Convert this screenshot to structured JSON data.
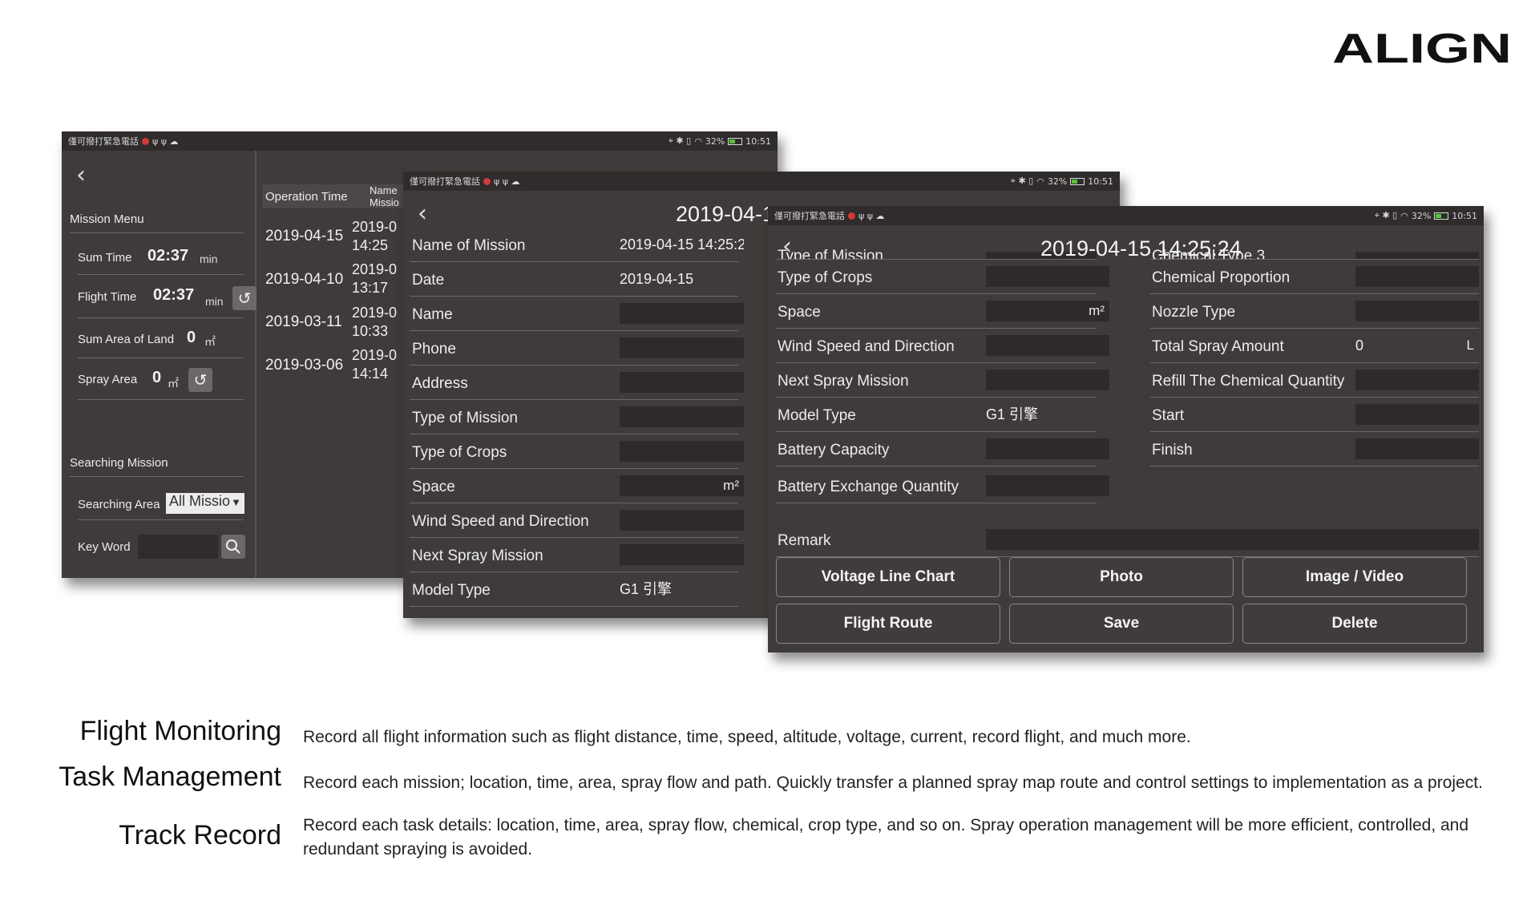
{
  "brand": {
    "logo_text": "ALIGN"
  },
  "status_bar": {
    "left_text": "僅可撥打緊急電話",
    "battery": "32%",
    "time": "10:51"
  },
  "screen1": {
    "mission_menu": "Mission Menu",
    "sum_time_label": "Sum Time",
    "sum_time_value": "02:37",
    "sum_time_unit": "min",
    "flight_time_label": "Flight Time",
    "flight_time_value": "02:37",
    "flight_time_unit": "min",
    "sum_area_label": "Sum Area of Land",
    "sum_area_value": "0",
    "area_unit": "㎡",
    "spray_area_label": "Spray Area",
    "spray_area_value": "0",
    "searching_mission": "Searching Mission",
    "searching_area_label": "Searching Area",
    "searching_area_value": "All Missio",
    "key_word_label": "Key Word",
    "columns": {
      "operation_time": "Operation Time",
      "name_line1": "Name",
      "name_line2": "Missio"
    },
    "rows": [
      {
        "date": "2019-04-15",
        "line1": "2019-0",
        "line2": "14:25"
      },
      {
        "date": "2019-04-10",
        "line1": "2019-0",
        "line2": "13:17"
      },
      {
        "date": "2019-03-11",
        "line1": "2019-0",
        "line2": "10:33"
      },
      {
        "date": "2019-03-06",
        "line1": "2019-0",
        "line2": "14:14"
      }
    ]
  },
  "screen2": {
    "title": "2019-04-1",
    "rows": [
      {
        "label": "Name of Mission",
        "value": "2019-04-15 14:25:2",
        "plain": true
      },
      {
        "label": "Date",
        "value": "2019-04-15",
        "plain": true
      },
      {
        "label": "Name",
        "value": ""
      },
      {
        "label": "Phone",
        "value": ""
      },
      {
        "label": "Address",
        "value": ""
      },
      {
        "label": "Type of Mission",
        "value": ""
      },
      {
        "label": "Type of Crops",
        "value": ""
      },
      {
        "label": "Space",
        "value": "",
        "unit": "m²"
      },
      {
        "label": "Wind Speed and Direction",
        "value": ""
      },
      {
        "label": "Next Spray Mission",
        "value": ""
      },
      {
        "label": "Model Type",
        "value": "G1 引擎",
        "plain": true
      }
    ]
  },
  "screen3": {
    "title": "2019-04-15 14:25:24",
    "partial_left": "Type of Mission",
    "partial_right": "Chemical Type 3",
    "left_rows": [
      {
        "label": "Type of Crops",
        "value": ""
      },
      {
        "label": "Space",
        "value": "",
        "unit": "m²"
      },
      {
        "label": "Wind Speed and Direction",
        "value": ""
      },
      {
        "label": "Next Spray Mission",
        "value": ""
      },
      {
        "label": "Model Type",
        "value": "G1 引擎",
        "plain": true
      },
      {
        "label": "Battery Capacity",
        "value": ""
      },
      {
        "label": "Battery Exchange Quantity",
        "value": ""
      }
    ],
    "right_rows": [
      {
        "label": "Chemical Proportion",
        "value": ""
      },
      {
        "label": "Nozzle Type",
        "value": ""
      },
      {
        "label": "Total Spray Amount",
        "value": "0",
        "unit": "L",
        "plain": true
      },
      {
        "label": "Refill The Chemical Quantity",
        "value": ""
      },
      {
        "label": "Start",
        "value": ""
      },
      {
        "label": "Finish",
        "value": ""
      }
    ],
    "remark_label": "Remark",
    "buttons": [
      "Voltage Line Chart",
      "Photo",
      "Image / Video",
      "Flight Route",
      "Save",
      "Delete"
    ]
  },
  "captions": [
    {
      "title": "Flight Monitoring",
      "text": "Record all flight information such as flight distance, time, speed, altitude, voltage, current, record flight, and much more."
    },
    {
      "title": "Task Management",
      "text": "Record each mission; location, time, area, spray flow and path. Quickly transfer a planned spray map route and control settings to implementation as a project."
    },
    {
      "title": "Track Record",
      "text": "Record each task details: location, time, area, spray flow, chemical, crop type, and so on. Spray operation management will be more efficient, controlled, and redundant spraying is avoided."
    }
  ]
}
